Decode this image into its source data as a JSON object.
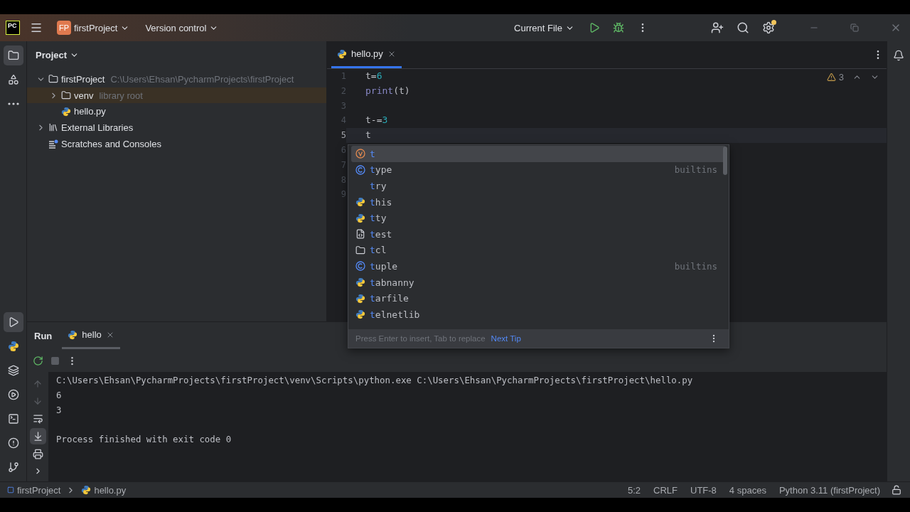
{
  "title_bar": {
    "logo": "PC",
    "project_badge": "FP",
    "project": "firstProject",
    "vcs": "Version control",
    "run_config": "Current File",
    "settings_update_dot": true
  },
  "tool_strip": {
    "top": [
      {
        "selected": true
      },
      {
        "selected": false
      },
      {
        "selected": false
      }
    ],
    "bottom": [
      {
        "selected": true
      },
      {
        "selected": false
      },
      {
        "selected": false
      },
      {
        "selected": false
      },
      {
        "selected": false
      },
      {
        "selected": false
      },
      {
        "selected": false
      }
    ]
  },
  "project_panel": {
    "title": "Project",
    "tree": [
      {
        "label": "firstProject",
        "hint": "C:\\Users\\Ehsan\\PycharmProjects\\firstProject",
        "kind": "folder",
        "expanded": true,
        "selected": false,
        "children": [
          {
            "label": "venv",
            "hint": "library root",
            "kind": "folder",
            "expanded": false,
            "selected": true
          },
          {
            "label": "hello.py",
            "kind": "python",
            "selected": false
          }
        ]
      },
      {
        "label": "External Libraries",
        "kind": "libraries",
        "expanded": false,
        "selected": false
      },
      {
        "label": "Scratches and Consoles",
        "kind": "scratches",
        "selected": false
      }
    ]
  },
  "editor": {
    "tabs": [
      {
        "label": "hello.py",
        "selected": true
      }
    ],
    "warnings": "3",
    "lines": [
      {
        "number": "1",
        "code": "t=6",
        "current": false
      },
      {
        "number": "2",
        "code": "print(t)",
        "current": false
      },
      {
        "number": "3",
        "current": false
      },
      {
        "number": "4",
        "code": "t-=3",
        "current": false
      },
      {
        "number": "5",
        "code": "t",
        "current": true
      },
      {
        "number": "6",
        "current": false
      },
      {
        "number": "7",
        "current": false
      },
      {
        "number": "8",
        "current": false
      },
      {
        "number": "9",
        "current": false
      }
    ]
  },
  "completion": {
    "items": [
      {
        "label": "t",
        "kind": "variable",
        "selected": true
      },
      {
        "label": "type",
        "kind": "class",
        "source": "builtins",
        "selected": false
      },
      {
        "label": "try",
        "kind": "keyword",
        "selected": false
      },
      {
        "label": "this",
        "kind": "module",
        "selected": false
      },
      {
        "label": "tty",
        "kind": "module",
        "selected": false
      },
      {
        "label": "test",
        "kind": "package",
        "selected": false
      },
      {
        "label": "tcl",
        "kind": "folder",
        "selected": false
      },
      {
        "label": "tuple",
        "kind": "class",
        "source": "builtins",
        "selected": false
      },
      {
        "label": "tabnanny",
        "kind": "module",
        "selected": false
      },
      {
        "label": "tarfile",
        "kind": "module",
        "selected": false
      },
      {
        "label": "telnetlib",
        "kind": "module",
        "selected": false
      }
    ],
    "footer": "Press Enter to insert, Tab to replace",
    "tip_link": "Next Tip"
  },
  "run_panel": {
    "title": "Run",
    "tabs": [
      {
        "label": "hello",
        "selected": true
      }
    ],
    "output": [
      {
        "text": "C:\\Users\\Ehsan\\PycharmProjects\\firstProject\\venv\\Scripts\\python.exe C:\\Users\\Ehsan\\PycharmProjects\\firstProject\\hello.py",
        "kind": "command"
      },
      {
        "text": "6",
        "kind": "stdout"
      },
      {
        "text": "3",
        "kind": "stdout"
      },
      {
        "text": "Process finished with exit code 0",
        "kind": "exit"
      }
    ]
  },
  "status_bar": {
    "breadcrumbs": [
      {
        "label": "firstProject",
        "kind": "module"
      },
      {
        "label": "hello.py",
        "kind": "python"
      }
    ],
    "items": [
      "5:2",
      "CRLF",
      "UTF-8",
      "4 spaces",
      "Python 3.11 (firstProject)"
    ]
  }
}
